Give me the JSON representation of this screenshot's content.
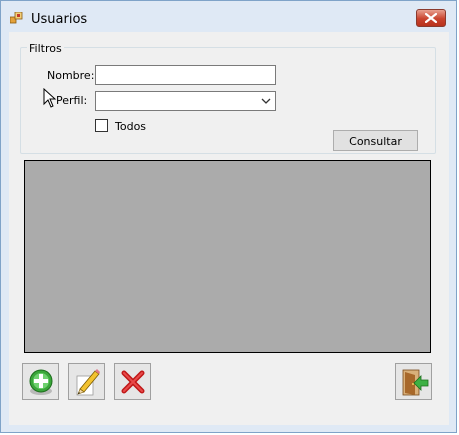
{
  "window": {
    "title": "Usuarios"
  },
  "filters": {
    "group_label": "Filtros",
    "nombre_label": "Nombre:",
    "nombre_value": "",
    "perfil_label": "Perfil:",
    "perfil_value": "",
    "todos_label": "Todos",
    "todos_checked": false,
    "consultar_label": "Consultar"
  },
  "toolbar": {
    "icons": [
      "add-icon",
      "edit-icon",
      "delete-icon",
      "exit-icon"
    ]
  },
  "colors": {
    "grid_background": "#ababab",
    "window_frame": "#dfe9f5",
    "close_button": "#c9432e"
  }
}
